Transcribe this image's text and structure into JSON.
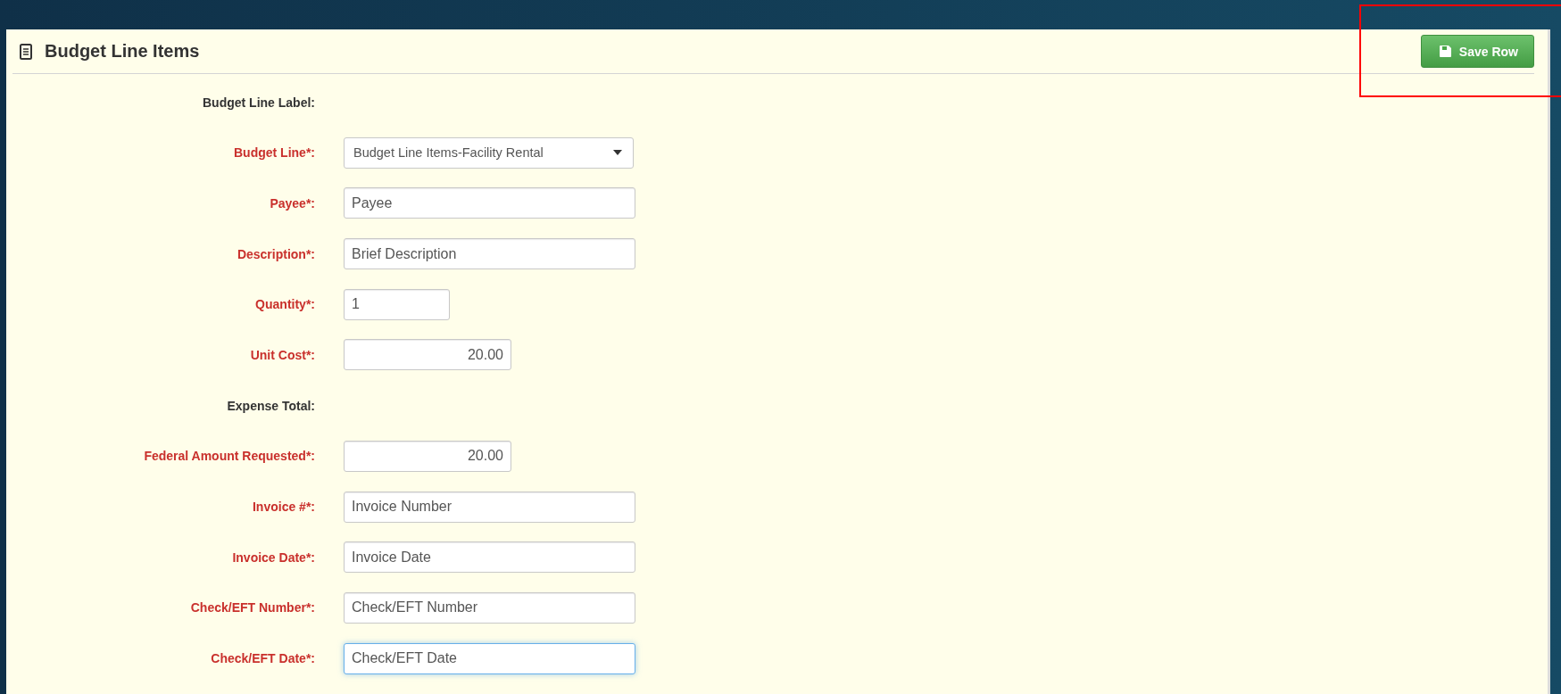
{
  "panel": {
    "title": "Budget Line Items",
    "save_button": "Save Row"
  },
  "annotation": {
    "kind": "highlight-frame",
    "color": "#ff0000"
  },
  "rows": [
    {
      "label": "Budget Line Label:",
      "required": false,
      "kind": "none"
    },
    {
      "label": "Budget Line*:",
      "required": true,
      "kind": "select",
      "value": "Budget Line Items-Facility Rental"
    },
    {
      "label": "Payee*:",
      "required": true,
      "kind": "text",
      "value": "Payee",
      "focused": false
    },
    {
      "label": "Description*:",
      "required": true,
      "kind": "text",
      "value": "Brief Description",
      "focused": false
    },
    {
      "label": "Quantity*:",
      "required": true,
      "kind": "short",
      "value": "1",
      "focused": false
    },
    {
      "label": "Unit Cost*:",
      "required": true,
      "kind": "amount",
      "value": "20.00",
      "focused": false
    },
    {
      "label": "Expense Total:",
      "required": false,
      "kind": "none"
    },
    {
      "label": "Federal Amount Requested*:",
      "required": true,
      "kind": "amount",
      "value": "20.00",
      "focused": false
    },
    {
      "label": "Invoice #*:",
      "required": true,
      "kind": "text",
      "value": "Invoice Number",
      "focused": false
    },
    {
      "label": "Invoice Date*:",
      "required": true,
      "kind": "text",
      "value": "Invoice Date",
      "focused": false
    },
    {
      "label": "Check/EFT Number*:",
      "required": true,
      "kind": "text",
      "value": "Check/EFT Number",
      "focused": false
    },
    {
      "label": "Check/EFT Date*:",
      "required": true,
      "kind": "text",
      "value": "Check/EFT Date",
      "focused": true
    }
  ]
}
